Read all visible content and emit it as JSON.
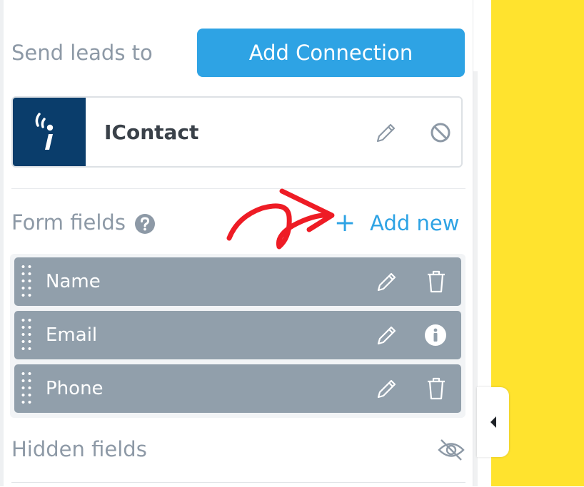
{
  "panel": {
    "send_leads_label": "Send leads to",
    "add_connection_label": "Add Connection",
    "connection": {
      "name": "IContact",
      "logo_icon": "icontact-logo-icon",
      "edit_icon": "pencil-icon",
      "disable_icon": "ban-icon"
    },
    "form_fields": {
      "label": "Form fields",
      "help_icon": "question-circle-icon",
      "add_new_plus": "+",
      "add_new_label": "Add new",
      "items": [
        {
          "name": "Name",
          "edit_icon": "pencil-icon",
          "action_icon": "trash-icon"
        },
        {
          "name": "Email",
          "edit_icon": "pencil-icon",
          "action_icon": "info-circle-icon"
        },
        {
          "name": "Phone",
          "edit_icon": "pencil-icon",
          "action_icon": "trash-icon"
        }
      ]
    },
    "hidden_fields": {
      "label": "Hidden fields",
      "toggle_icon": "eye-slash-icon"
    }
  },
  "colors": {
    "accent": "#2ea3e4",
    "field_row": "#919fab",
    "canvas_background": "#ffe32e",
    "annotation_arrow": "#ee1c25",
    "icontact_brand": "#0a3d6b"
  }
}
